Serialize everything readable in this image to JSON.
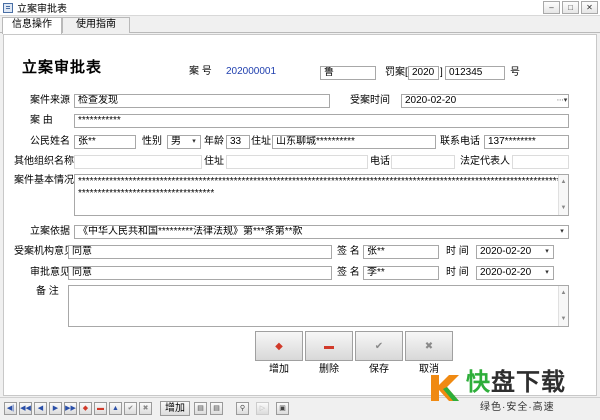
{
  "window": {
    "title": "立案审批表"
  },
  "window_controls": [
    "minimize",
    "maximize",
    "close"
  ],
  "tabs": [
    {
      "label": "信息操作",
      "active": true
    },
    {
      "label": "使用指南",
      "active": false
    }
  ],
  "form": {
    "title": "立案审批表",
    "case_no_label": "案    号",
    "case_no_value": "202000001",
    "region_prefix": "鲁",
    "penalty_label": "罚案[",
    "penalty_year": "2020",
    "penalty_bracket": "]",
    "penalty_number": "012345",
    "number_suffix": "号",
    "source_label": "案件来源",
    "source_value": "检查发现",
    "accept_time_label": "受案时间",
    "accept_time_value": "2020-02-20",
    "cause_label": "案    由",
    "cause_value": "***********",
    "citizen_name_label": "公民姓名",
    "citizen_name_value": "张**",
    "gender_label": "性别",
    "gender_value": "男",
    "age_label": "年龄",
    "age_value": "33",
    "address_label": "住址",
    "address_value": "山东聊城**********",
    "phone_label": "联系电话",
    "phone_value": "137********",
    "org_name_label": "其他组织名称",
    "org_name_value": "",
    "org_address_label": "住址",
    "org_address_value": "",
    "org_phone_label": "电话",
    "org_phone_value": "",
    "legal_rep_label": "法定代表人",
    "legal_rep_value": "",
    "basic_info_label": "案件基本情况",
    "basic_info_value": "****************************************************************************************************************************************************************",
    "basis_label": "立案依据",
    "basis_value": "《中华人民共和国*********法律法规》第***条第**款",
    "agency_opinion_label": "受案机构意见",
    "agency_opinion_value": "同意",
    "sign_label_1": "签  名",
    "sign_value_1": "张**",
    "time_label_1": "时  间",
    "time_value_1": "2020-02-20",
    "approval_label": "审批意见",
    "approval_value": "同意",
    "sign_label_2": "签  名",
    "sign_value_2": "李**",
    "time_label_2": "时  间",
    "time_value_2": "2020-02-20",
    "remark_label": "备    注",
    "remark_value": ""
  },
  "actions": {
    "add": "增加",
    "delete": "删除",
    "save": "保存",
    "cancel": "取消"
  },
  "statusbar": {
    "add_label": "增加"
  },
  "watermark": {
    "name_1": "快",
    "name_2": "盘下载",
    "tagline": "绿色·安全·高速"
  },
  "colors": {
    "accent_blue": "#1f3fae",
    "add_red": "#d13a2a",
    "logo_orange": "#f08a12",
    "logo_green": "#2eae3a"
  }
}
